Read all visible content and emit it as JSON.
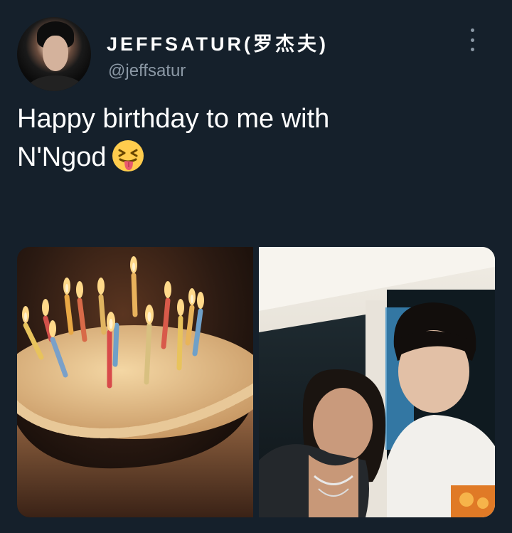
{
  "tweet": {
    "display_name": "JEFFSATUR(罗杰夫)",
    "handle": "@jeffsatur",
    "text_line1": "Happy birthday to me with",
    "text_line2": "N'Ngod",
    "emoji": "squinting-face-with-tongue"
  },
  "media": [
    {
      "description": "birthday cake with lit candles"
    },
    {
      "description": "selfie of two people"
    }
  ],
  "colors": {
    "background": "#15202b",
    "text": "#ffffff",
    "secondary_text": "#8b98a5"
  }
}
